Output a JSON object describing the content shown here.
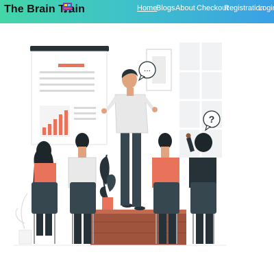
{
  "brand": {
    "name": "The Brain Train",
    "logo_icon": "train-logo-icon"
  },
  "nav": {
    "items": [
      {
        "label": "Home",
        "active": true
      },
      {
        "label": "Blogs",
        "active": false
      },
      {
        "label": "About",
        "active": false
      },
      {
        "label": "Checkout",
        "active": false
      },
      {
        "label": "Registration",
        "active": false
      },
      {
        "label": "Login",
        "active": false
      }
    ]
  },
  "hero": {
    "illustration": "presenter-classroom-illustration",
    "speech_bubble_text": "...",
    "question_bubble_text": "?"
  },
  "colors": {
    "gradient_start": "#43d6a8",
    "gradient_end": "#3aa0e6",
    "accent": "#e8735a",
    "dark_slate": "#37474f"
  }
}
